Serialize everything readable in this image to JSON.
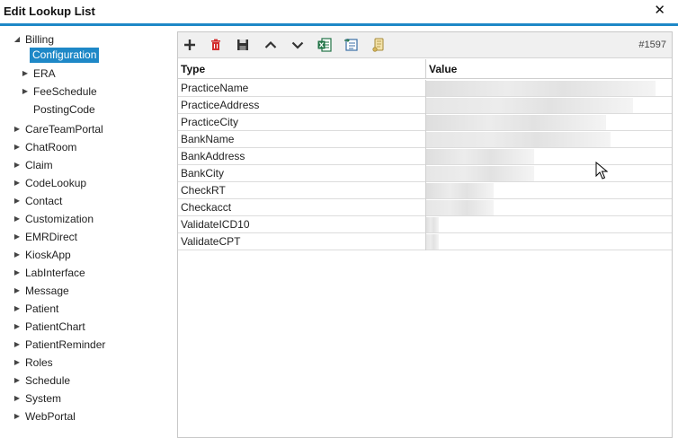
{
  "window": {
    "title": "Edit Lookup List",
    "close_label": "✕"
  },
  "tree": {
    "billing": {
      "label": "Billing",
      "children": [
        {
          "label": "Configuration",
          "selected": true
        },
        {
          "label": "ERA"
        },
        {
          "label": "FeeSchedule"
        },
        {
          "label": "PostingCode"
        }
      ]
    },
    "items": [
      {
        "label": "CareTeamPortal"
      },
      {
        "label": "ChatRoom"
      },
      {
        "label": "Claim"
      },
      {
        "label": "CodeLookup"
      },
      {
        "label": "Contact"
      },
      {
        "label": "Customization"
      },
      {
        "label": "EMRDirect"
      },
      {
        "label": "KioskApp"
      },
      {
        "label": "LabInterface"
      },
      {
        "label": "Message"
      },
      {
        "label": "Patient"
      },
      {
        "label": "PatientChart"
      },
      {
        "label": "PatientReminder"
      },
      {
        "label": "Roles"
      },
      {
        "label": "Schedule"
      },
      {
        "label": "System"
      },
      {
        "label": "WebPortal"
      }
    ]
  },
  "toolbar": {
    "icons": [
      "add-icon",
      "delete-icon",
      "save-icon",
      "move-up-icon",
      "move-down-icon",
      "excel-export-icon",
      "import-icon",
      "scroll-icon"
    ],
    "record_count": "#1597"
  },
  "grid": {
    "headers": {
      "type": "Type",
      "value": "Value"
    },
    "rows": [
      {
        "type": "PracticeName"
      },
      {
        "type": "PracticeAddress"
      },
      {
        "type": "PracticeCity"
      },
      {
        "type": "BankName"
      },
      {
        "type": "BankAddress"
      },
      {
        "type": "BankCity"
      },
      {
        "type": "CheckRT"
      },
      {
        "type": "Checkacct"
      },
      {
        "type": "ValidateICD10"
      },
      {
        "type": "ValidateCPT"
      }
    ]
  },
  "colors": {
    "accent": "#1e88c7",
    "selection": "#1e88c7",
    "delete_red": "#d32f2f",
    "excel_green": "#217346"
  }
}
